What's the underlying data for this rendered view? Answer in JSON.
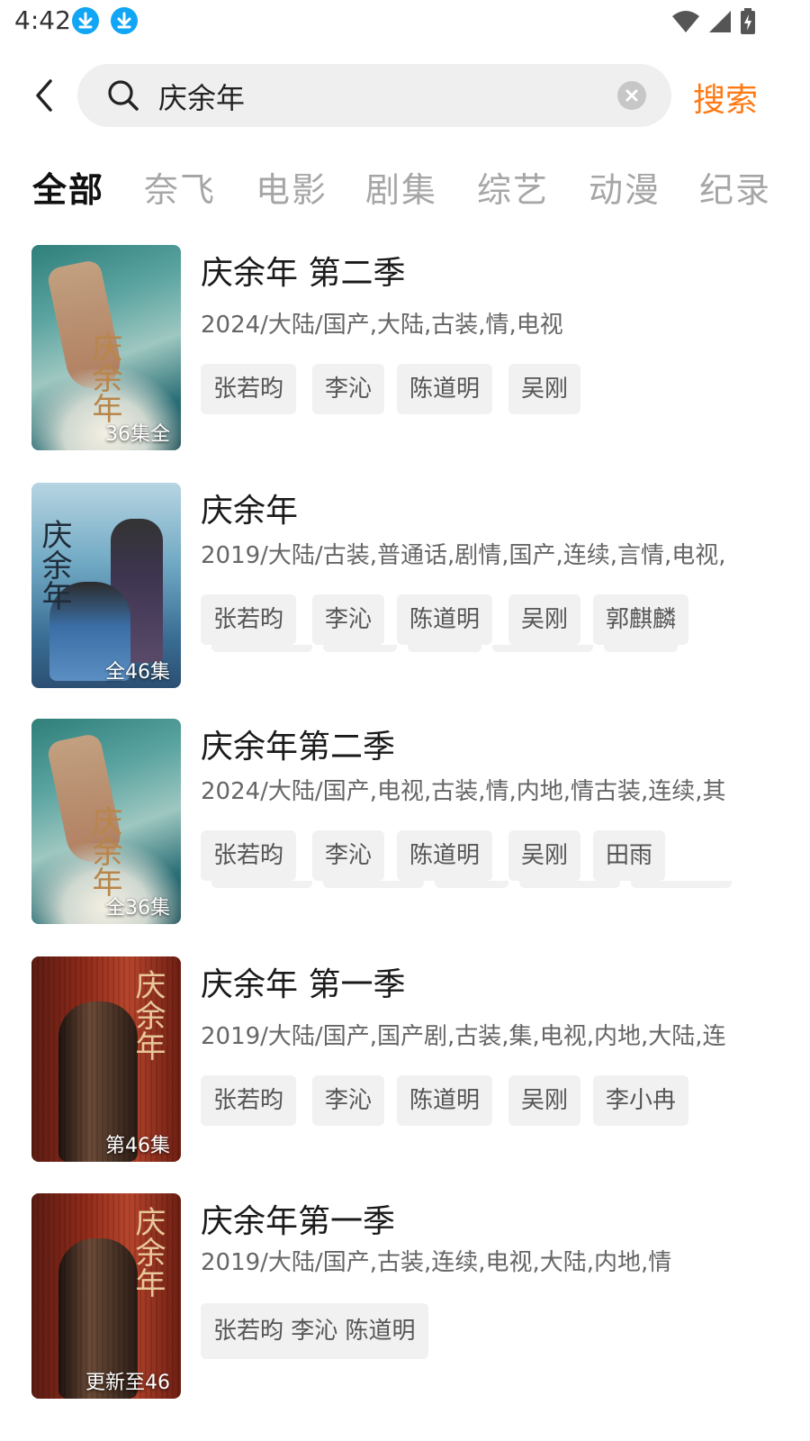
{
  "status_bar": {
    "time": "4:42"
  },
  "search": {
    "query": "庆余年",
    "button_label": "搜索"
  },
  "tabs": [
    "全部",
    "奈飞",
    "电影",
    "剧集",
    "综艺",
    "动漫",
    "纪录"
  ],
  "results": [
    {
      "title": "庆余年 第二季",
      "meta": "2024/大陆/国产,大陆,古装,情,电视",
      "badge": "36集全",
      "poster_text": "庆余年",
      "cast": [
        "张若昀",
        "李沁",
        "陈道明",
        "吴刚"
      ]
    },
    {
      "title": "庆余年",
      "meta": "2019/大陆/古装,普通话,剧情,国产,连续,言情,电视,",
      "badge": "全46集",
      "poster_text": "庆余年",
      "cast": [
        "张若昀",
        "李沁",
        "陈道明",
        "吴刚",
        "郭麒麟"
      ]
    },
    {
      "title": "庆余年第二季",
      "meta": "2024/大陆/国产,电视,古装,情,内地,情古装,连续,其",
      "badge": "全36集",
      "poster_text": "庆余年",
      "cast": [
        "张若昀",
        "李沁",
        "陈道明",
        "吴刚",
        "田雨"
      ]
    },
    {
      "title": "庆余年 第一季",
      "meta": "2019/大陆/国产,国产剧,古装,集,电视,内地,大陆,连",
      "badge": "第46集",
      "poster_text": "庆余年",
      "cast": [
        "张若昀",
        "李沁",
        "陈道明",
        "吴刚",
        "李小冉"
      ]
    },
    {
      "title": "庆余年第一季",
      "meta": "2019/大陆/国产,古装,连续,电视,大陆,内地,情",
      "badge": "更新至46",
      "poster_text": "庆余年",
      "cast_line": "张若昀 李沁  陈道明"
    }
  ],
  "colors": {
    "accent": "#ff7a14",
    "tab_inactive": "#a6a6a6",
    "tag_bg": "#f1f1f1"
  }
}
